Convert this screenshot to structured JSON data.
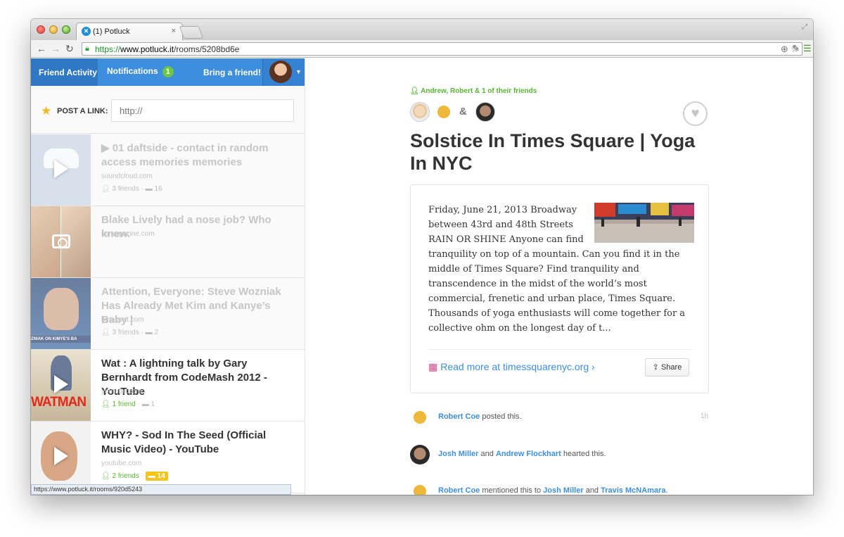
{
  "browser": {
    "tab_title": "(1) Potluck",
    "tab_close": "×",
    "url_scheme": "https://",
    "url_host": "www.potluck.it",
    "url_path": "/rooms/5208bd6e",
    "status_url": "https://www.potluck.it/rooms/920d5243"
  },
  "nav": {
    "friend_activity": "Friend Activity",
    "notifications": "Notifications",
    "notifications_count": "1",
    "bring_friend": "Bring a friend!"
  },
  "post_link": {
    "label": "POST A LINK:",
    "placeholder": "http://"
  },
  "feed": [
    {
      "title": "▶ 01 daftside - contact in random access memories memories",
      "source": "soundcloud.com",
      "friends": "3 friends",
      "comments": "16"
    },
    {
      "title": "Blake Lively had a nose job? Who knew.",
      "source": "usmagazine.com"
    },
    {
      "title": "Attention, Everyone: Steve Wozniak Has Already Met Kim and Kanye’s Baby |",
      "source": "betabeat.com",
      "friends": "3 friends",
      "comments": "2",
      "thumb_caption": "ZNIAK ON KIMYE'S BA"
    },
    {
      "title": "Wat : A lightning talk by Gary Bernhardt from CodeMash 2012 - YouTube",
      "source": "youtube.com",
      "friends": "1 friend",
      "comments": "1",
      "thumb_caption": "WATMAN"
    },
    {
      "title": "WHY? - Sod In The Seed (Official Music Video) - YouTube",
      "source": "youtube.com",
      "friends": "2 friends",
      "comments": "14"
    }
  ],
  "main": {
    "context": "Andrew, Robert & 1 of their friends",
    "amp": "&",
    "headline": "Solstice In Times Square | Yoga In NYC",
    "excerpt": "Friday, June 21, 2013 Broadway between 43rd and 48th Streets RAIN OR SHINE Anyone can find tranquility on top of a mountain. Can you find it in the middle of Times Square? Find tranquility and transcendence in the midst of the world’s most commercial, frenetic and urban place, Times Square. Thousands of yoga enthusiasts will come together for a collective ohm on the longest day of t...",
    "read_more": "Read more at timessquarenyc.org",
    "share": "Share"
  },
  "activity": [
    {
      "name1": "Robert Coe",
      "text1": " posted this.",
      "time": "1h"
    },
    {
      "name1": "Josh Miller",
      "text1": " and ",
      "name2": "Andrew Flockhart",
      "text2": " hearted this."
    },
    {
      "name1": "Robert Coe",
      "text1": " mentioned this to ",
      "name2": "Josh Miller",
      "text2": " and ",
      "name3": "Travis McNAmara",
      "text3": "."
    }
  ],
  "colors": {
    "nav_blue": "#3e8ede",
    "green": "#58b534",
    "badge_yellow": "#f5c51b"
  }
}
